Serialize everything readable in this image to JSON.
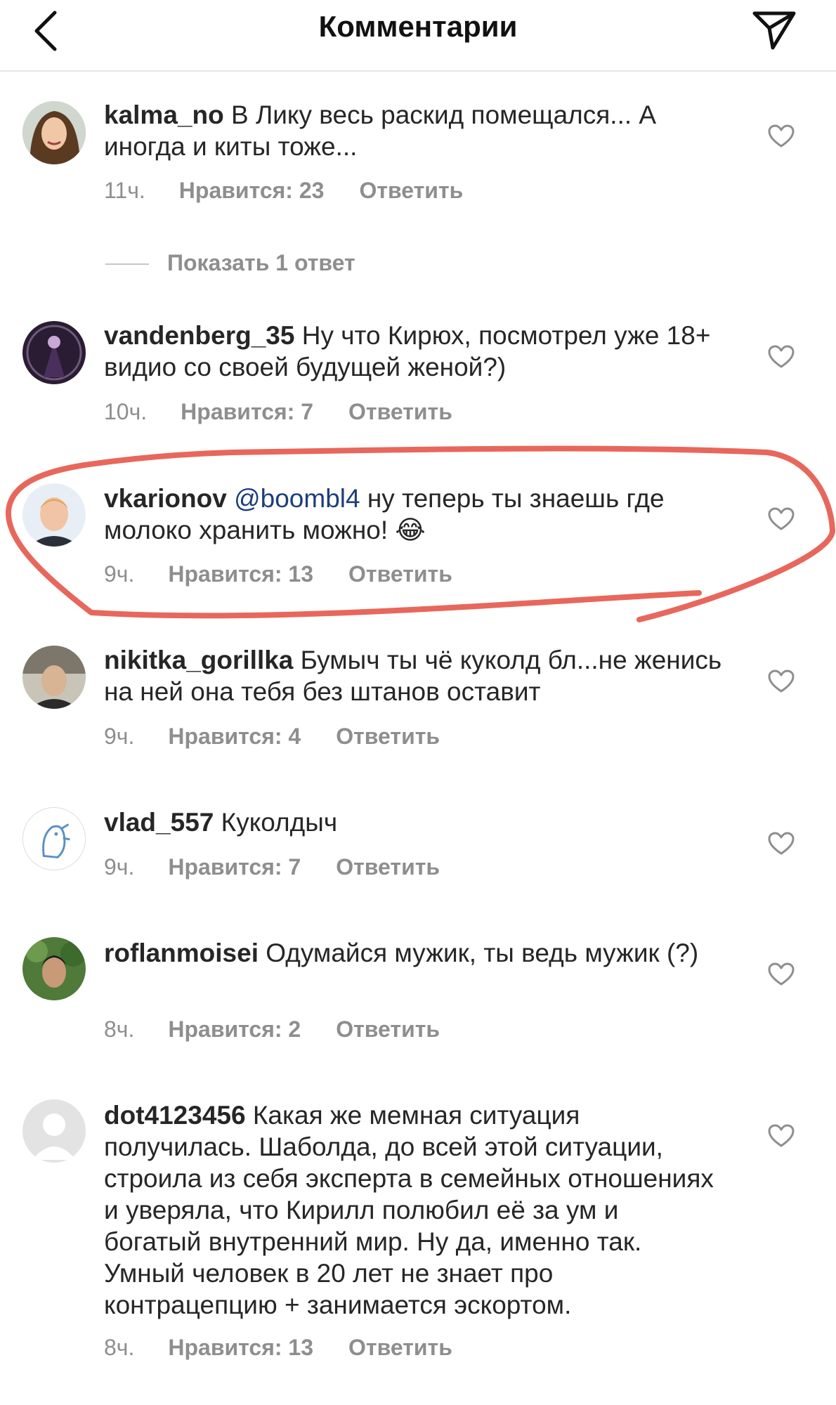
{
  "header": {
    "title": "Комментарии"
  },
  "show_replies_label": "Показать 1 ответ",
  "comments": [
    {
      "username": "kalma_no",
      "text": "В Лику весь раскид помещался... А иногда и киты тоже...",
      "time": "11ч.",
      "likes": "Нравится: 23",
      "reply": "Ответить"
    },
    {
      "username": "vandenberg_35",
      "text": "Ну что Кирюх, посмотрел уже 18+ видио со своей будущей женой?)",
      "time": "10ч.",
      "likes": "Нравится: 7",
      "reply": "Ответить"
    },
    {
      "username": "vkarionov",
      "mention": "@boombl4",
      "text": "ну теперь ты знаешь где молоко хранить можно! 😂",
      "time": "9ч.",
      "likes": "Нравится: 13",
      "reply": "Ответить"
    },
    {
      "username": "nikitka_gorillka",
      "text": "Бумыч ты чё куколд бл...не женись на ней она тебя без штанов оставит",
      "time": "9ч.",
      "likes": "Нравится: 4",
      "reply": "Ответить"
    },
    {
      "username": "vlad_557",
      "text": "Куколдыч",
      "time": "9ч.",
      "likes": "Нравится: 7",
      "reply": "Ответить"
    },
    {
      "username": "roflanmoisei",
      "text": "Одумайся мужик, ты ведь мужик (?)",
      "time": "8ч.",
      "likes": "Нравится: 2",
      "reply": "Ответить"
    },
    {
      "username": "dot4123456",
      "text": "Какая же мемная ситуация получилась. Шаболда, до всей этой ситуации, строила из себя эксперта в семейных отношениях и уверяла, что Кирилл полюбил её за ум и богатый внутренний мир. Ну да, именно так. Умный человек в 20 лет не знает про контрацепцию + занимается эскортом.",
      "time": "8ч.",
      "likes": "Нравится: 13",
      "reply": "Ответить"
    }
  ],
  "colors": {
    "highlight_annotation": "#e8675c",
    "meta_gray": "#8e8e8e",
    "mention_blue": "#1d3e7a"
  }
}
